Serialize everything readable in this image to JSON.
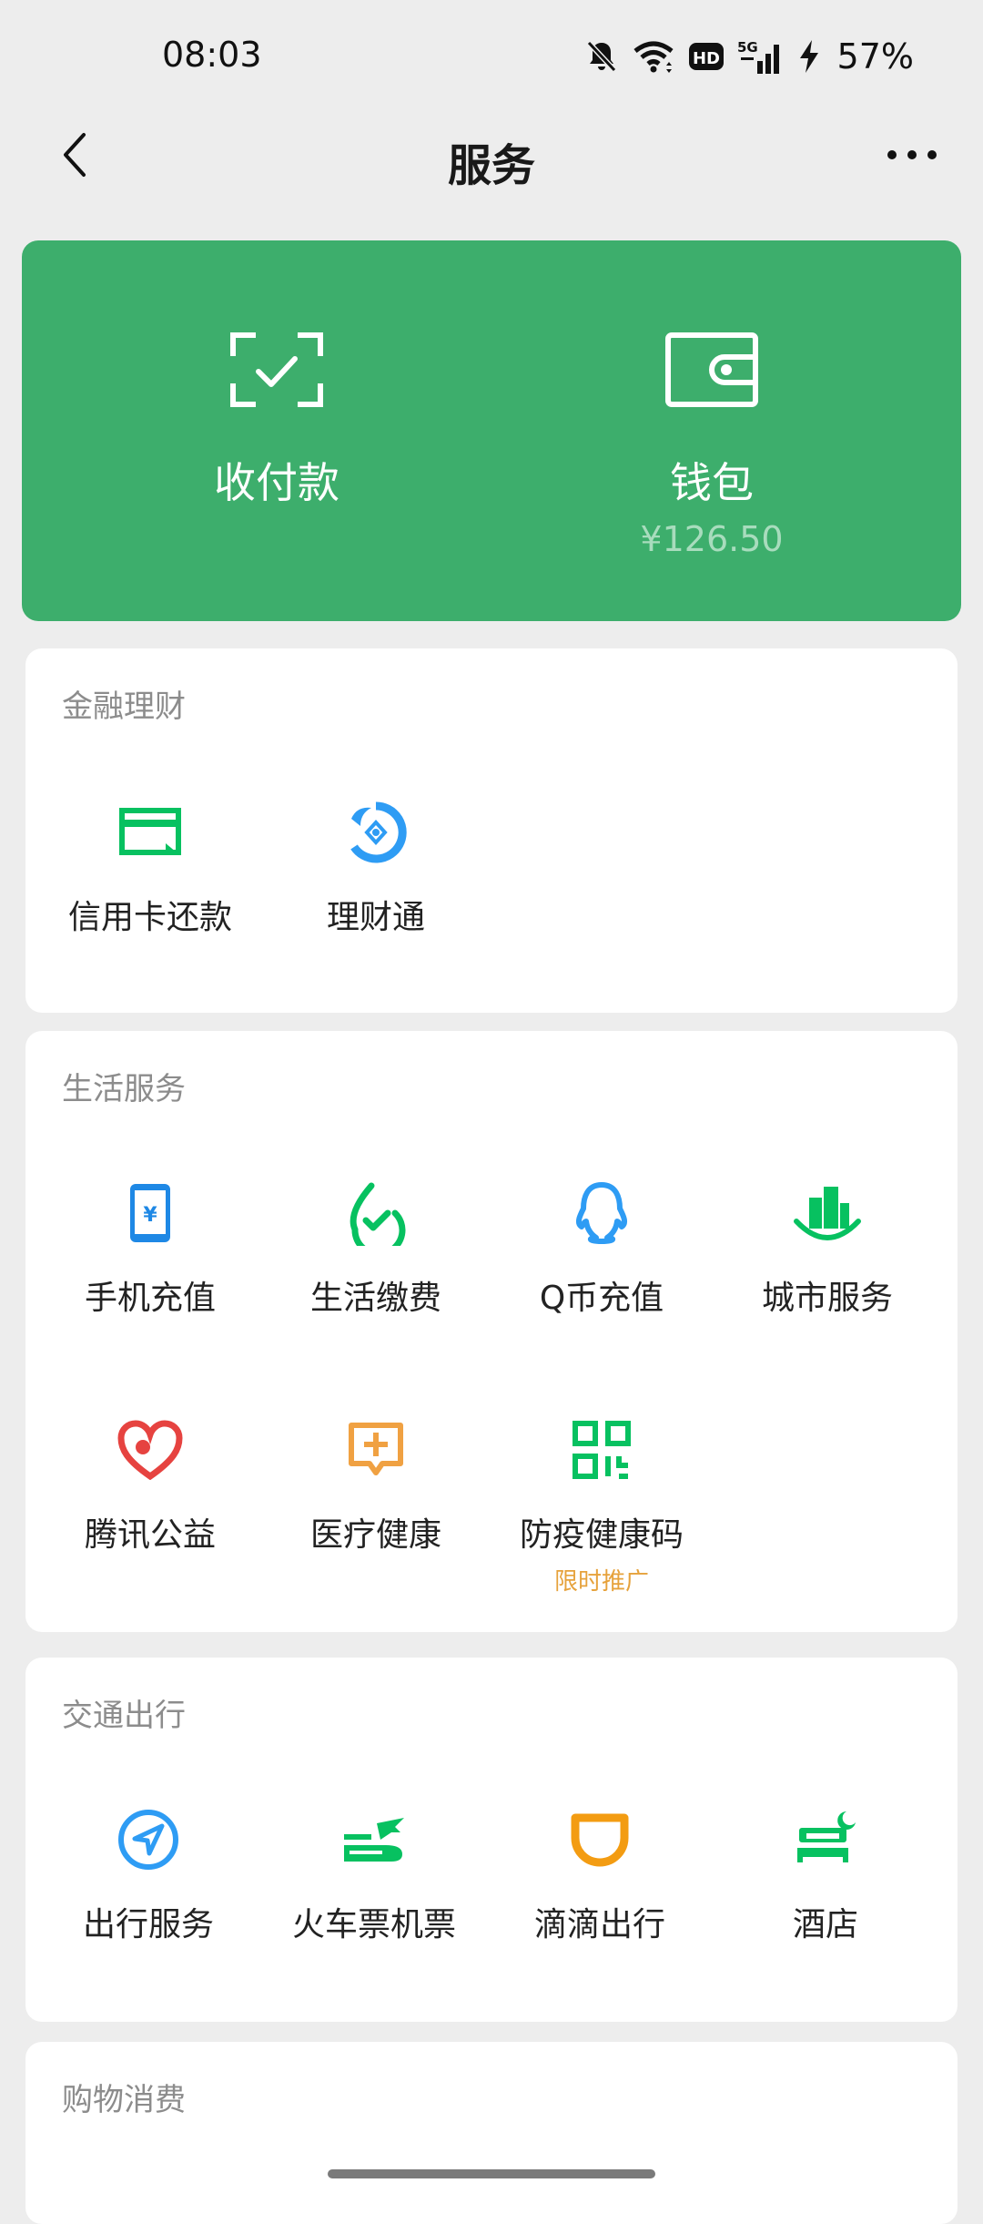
{
  "status_bar": {
    "time": "08:03",
    "battery": "57%"
  },
  "nav": {
    "title": "服务"
  },
  "wallet": {
    "pay": {
      "label": "收付款",
      "icon": "scan-check-icon"
    },
    "purse": {
      "label": "钱包",
      "balance": "¥126.50",
      "icon": "wallet-icon"
    }
  },
  "sections": {
    "finance": {
      "title": "金融理财",
      "items": [
        {
          "label": "信用卡还款",
          "icon": "credit-card-icon",
          "color": "#07c160"
        },
        {
          "label": "理财通",
          "icon": "wealth-icon",
          "color": "#2e9cf4"
        }
      ]
    },
    "life": {
      "title": "生活服务",
      "items": [
        {
          "label": "手机充值",
          "icon": "phone-recharge-icon",
          "color": "#1e88e5"
        },
        {
          "label": "生活缴费",
          "icon": "utility-bill-icon",
          "color": "#07c160"
        },
        {
          "label": "Q币充值",
          "icon": "qq-coin-icon",
          "color": "#2e9cf4"
        },
        {
          "label": "城市服务",
          "icon": "city-service-icon",
          "color": "#07c160"
        },
        {
          "label": "腾讯公益",
          "icon": "charity-heart-icon",
          "color": "#e64340"
        },
        {
          "label": "医疗健康",
          "icon": "medical-icon",
          "color": "#f0a142"
        },
        {
          "label": "防疫健康码",
          "icon": "health-code-icon",
          "color": "#07c160",
          "tag": "限时推广"
        }
      ]
    },
    "travel": {
      "title": "交通出行",
      "items": [
        {
          "label": "出行服务",
          "icon": "navigation-icon",
          "color": "#2e9cf4"
        },
        {
          "label": "火车票机票",
          "icon": "train-plane-icon",
          "color": "#07c160"
        },
        {
          "label": "滴滴出行",
          "icon": "didi-icon",
          "color": "#f39c12"
        },
        {
          "label": "酒店",
          "icon": "hotel-bed-icon",
          "color": "#07c160"
        }
      ]
    },
    "shopping": {
      "title": "购物消费"
    }
  }
}
